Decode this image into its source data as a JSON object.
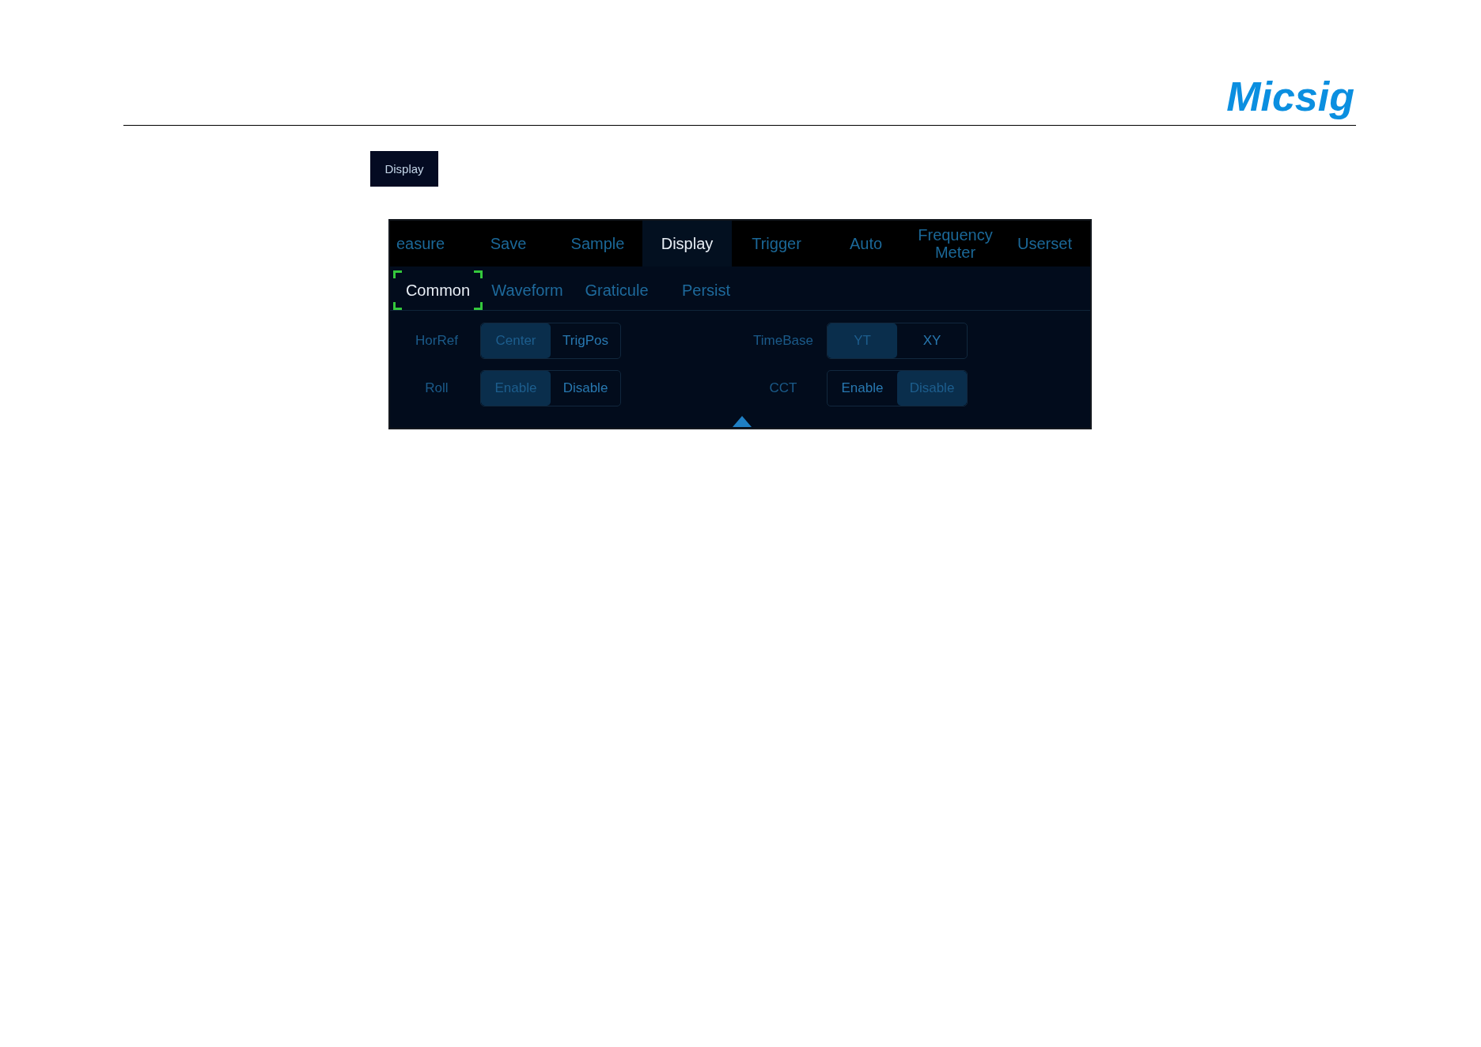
{
  "header": {
    "logo": "Micsig"
  },
  "key_button": {
    "label": "Display"
  },
  "panel": {
    "tabs": [
      {
        "label": "easure",
        "selected": false
      },
      {
        "label": "Save",
        "selected": false
      },
      {
        "label": "Sample",
        "selected": false
      },
      {
        "label": "Display",
        "selected": true
      },
      {
        "label": "Trigger",
        "selected": false
      },
      {
        "label": "Auto",
        "selected": false
      },
      {
        "label": "Frequency Meter",
        "selected": false
      },
      {
        "label": "Userset",
        "selected": false
      }
    ],
    "subtabs": [
      {
        "label": "Common",
        "selected": true
      },
      {
        "label": "Waveform",
        "selected": false
      },
      {
        "label": "Graticule",
        "selected": false
      },
      {
        "label": "Persist",
        "selected": false
      }
    ],
    "settings": [
      {
        "label": "HorRef",
        "options": [
          {
            "label": "Center",
            "selected": true
          },
          {
            "label": "TrigPos",
            "selected": false
          }
        ]
      },
      {
        "label": "TimeBase",
        "options": [
          {
            "label": "YT",
            "selected": true
          },
          {
            "label": "XY",
            "selected": false
          }
        ]
      },
      {
        "label": "Roll",
        "options": [
          {
            "label": "Enable",
            "selected": true
          },
          {
            "label": "Disable",
            "selected": false
          }
        ]
      },
      {
        "label": "CCT",
        "options": [
          {
            "label": "Enable",
            "selected": false
          },
          {
            "label": "Disable",
            "selected": true
          }
        ]
      }
    ]
  }
}
